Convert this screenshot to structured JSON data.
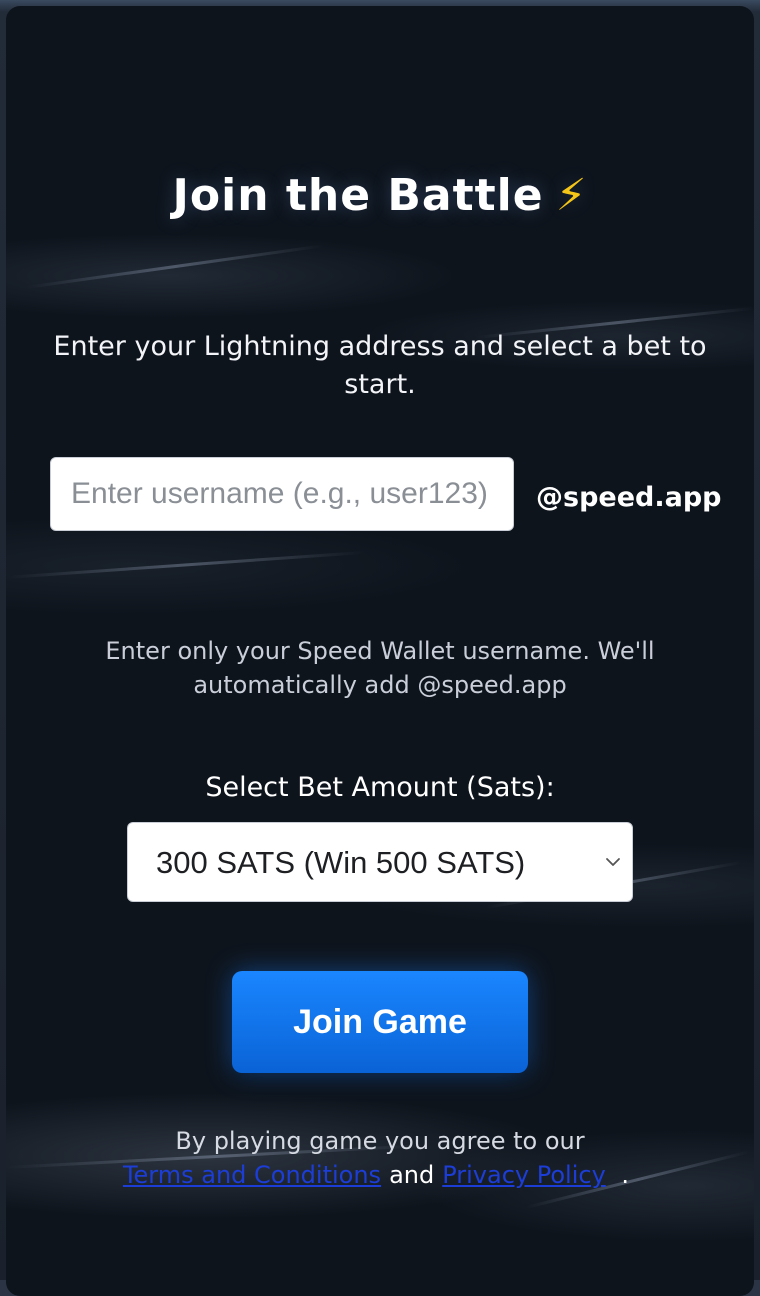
{
  "title": "Join the Battle",
  "title_icon": "lightning-bolt-icon",
  "intro": "Enter your Lightning address and select a bet to start.",
  "username": {
    "placeholder": "Enter username (e.g., user123)",
    "value": "",
    "suffix": "@speed.app"
  },
  "hint": "Enter only your Speed Wallet username. We'll automatically add @speed.app",
  "bet": {
    "label": "Select Bet Amount (Sats):",
    "selected": "300 SATS (Win 500 SATS)"
  },
  "join_button": "Join Game",
  "terms": {
    "prefix": "By playing game you agree to our",
    "terms_link": "Terms and Conditions",
    "conjunction": "and",
    "privacy_link": "Privacy Policy",
    "suffix": "."
  },
  "colors": {
    "background": "#0e141c",
    "accent": "#1a86ff",
    "bolt": "#f5c518",
    "link": "#1c3dd6"
  }
}
